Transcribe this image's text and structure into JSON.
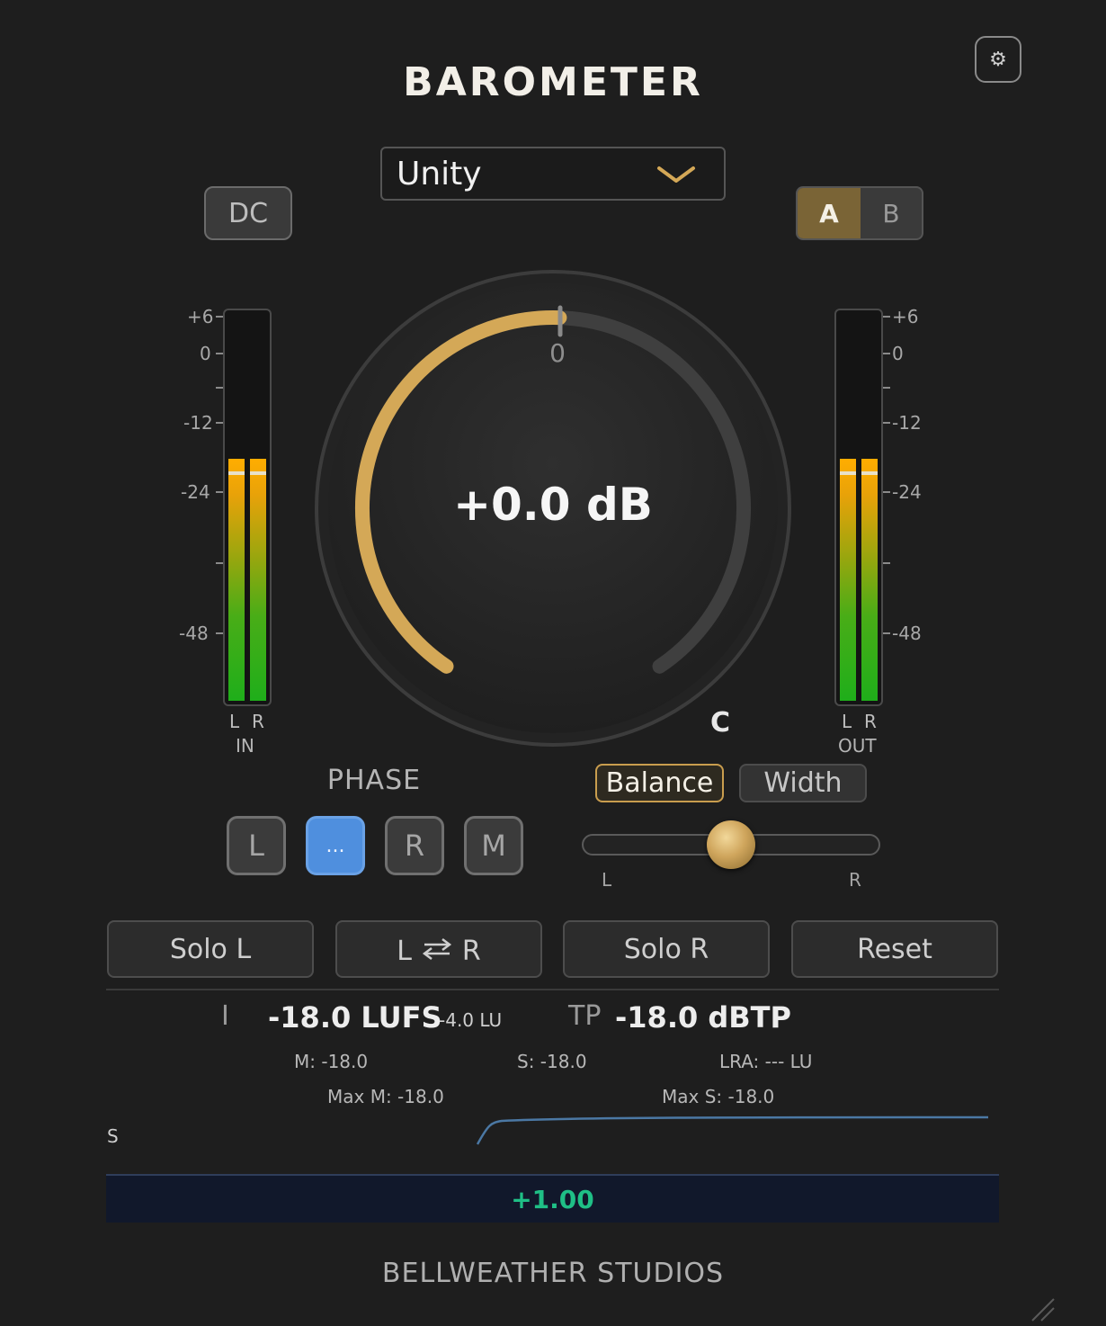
{
  "header": {
    "title": "BAROMETER",
    "settings_icon": "gear-icon"
  },
  "preset": {
    "selected": "Unity",
    "chevron_icon": "chevron-down-icon"
  },
  "dc_button": {
    "label": "DC"
  },
  "ab_switch": {
    "a_label": "A",
    "b_label": "B",
    "selected": "A"
  },
  "meters": {
    "scale_in": [
      "+6",
      "0",
      "-12",
      "-24",
      "-48"
    ],
    "scale_out": [
      "+6",
      "0",
      "-12",
      "-24",
      "-48"
    ],
    "in": {
      "l_label": "L",
      "r_label": "R",
      "name": "IN",
      "level_fraction": 0.62
    },
    "out": {
      "l_label": "L",
      "r_label": "R",
      "name": "OUT",
      "level_fraction": 0.62
    }
  },
  "gain_knob": {
    "value_text": "+0.0 dB",
    "zero_label": "0",
    "value_db": 0.0
  },
  "center_label": "C",
  "phase": {
    "title": "PHASE",
    "buttons": [
      {
        "label": "L",
        "active": false
      },
      {
        "label": "...",
        "active": true
      },
      {
        "label": "R",
        "active": false
      },
      {
        "label": "M",
        "active": false
      }
    ]
  },
  "stereo_mode": {
    "balance_label": "Balance",
    "width_label": "Width",
    "selected": "Balance"
  },
  "balance_slider": {
    "left_label": "L",
    "right_label": "R",
    "position_fraction": 0.5
  },
  "actions": {
    "solo_l": "Solo L",
    "swap_l": "L",
    "swap_r": "R",
    "swap_icon": "swap-arrows-icon",
    "solo_r": "Solo R",
    "reset": "Reset"
  },
  "loudness": {
    "i_label": "I",
    "lufs": "-18.0 LUFS",
    "lu": "-4.0 LU",
    "tp_label": "TP",
    "dbtp": "-18.0 dBTP",
    "m": "M: -18.0",
    "s": "S: -18.0",
    "lra": "LRA: --- LU",
    "max_m": "Max M: -18.0",
    "max_s": "Max S: -18.0"
  },
  "history": {
    "s_label": "S",
    "readout": "+1.00"
  },
  "footer": {
    "brand": "BELLWEATHER STUDIOS"
  },
  "colors": {
    "accent": "#d4a857",
    "phase_active": "#4f8fde",
    "readout_green": "#1fbf86"
  }
}
